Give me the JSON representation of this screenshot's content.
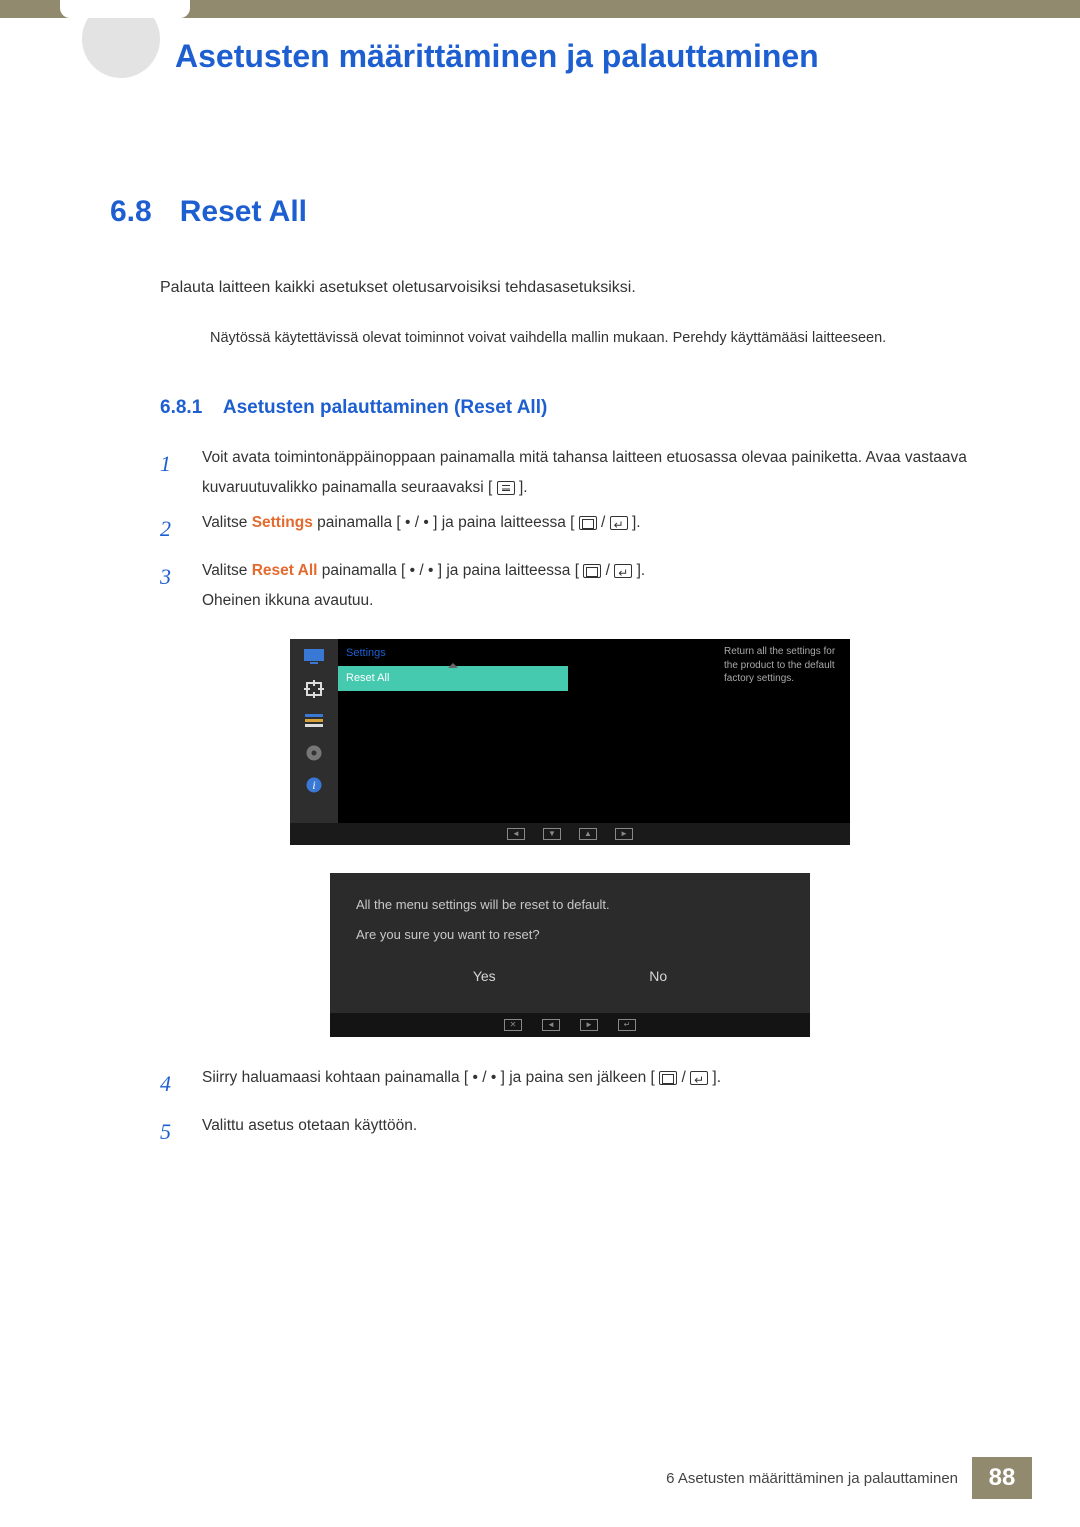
{
  "chapter_title": "Asetusten määrittäminen ja palauttaminen",
  "section": {
    "number": "6.8",
    "title": "Reset All"
  },
  "intro": "Palauta laitteen kaikki asetukset oletusarvoisiksi tehdasasetuksiksi.",
  "note": "Näytössä käytettävissä olevat toiminnot voivat vaihdella mallin mukaan. Perehdy käyttämääsi laitteeseen.",
  "subsection": {
    "number": "6.8.1",
    "title": "Asetusten palauttaminen (Reset All)"
  },
  "steps": [
    {
      "n": "1",
      "pre": "Voit avata toimintonäppäinoppaan painamalla mitä tahansa laitteen etuosassa olevaa painiketta. Avaa vastaava kuvaruutuvalikko painamalla seuraavaksi [",
      "post": "].",
      "icons": [
        "menu"
      ]
    },
    {
      "n": "2",
      "pre": "Valitse ",
      "bold": "Settings",
      "mid": " painamalla [ • / • ] ja paina laitteessa [",
      "post": "].",
      "icons": [
        "src",
        "enter"
      ]
    },
    {
      "n": "3",
      "pre": "Valitse ",
      "bold": "Reset All",
      "mid": " painamalla [ • / • ] ja paina laitteessa [",
      "post": "].",
      "after": "Oheinen ikkuna avautuu.",
      "icons": [
        "src",
        "enter"
      ]
    },
    {
      "n": "4",
      "pre": "Siirry haluamaasi kohtaan painamalla [ • / • ] ja paina sen jälkeen [",
      "post": "].",
      "icons": [
        "src",
        "enter"
      ]
    },
    {
      "n": "5",
      "pre": "Valittu asetus otetaan käyttöön."
    }
  ],
  "osd": {
    "breadcrumb": "Settings",
    "selected": "Reset All",
    "description": "Return all the settings for the product to the default factory settings."
  },
  "dialog": {
    "line1": "All the menu settings will be reset to default.",
    "line2": "Are you sure you want to reset?",
    "yes": "Yes",
    "no": "No"
  },
  "footer": {
    "text": "6 Asetusten määrittäminen ja palauttaminen",
    "page": "88"
  }
}
